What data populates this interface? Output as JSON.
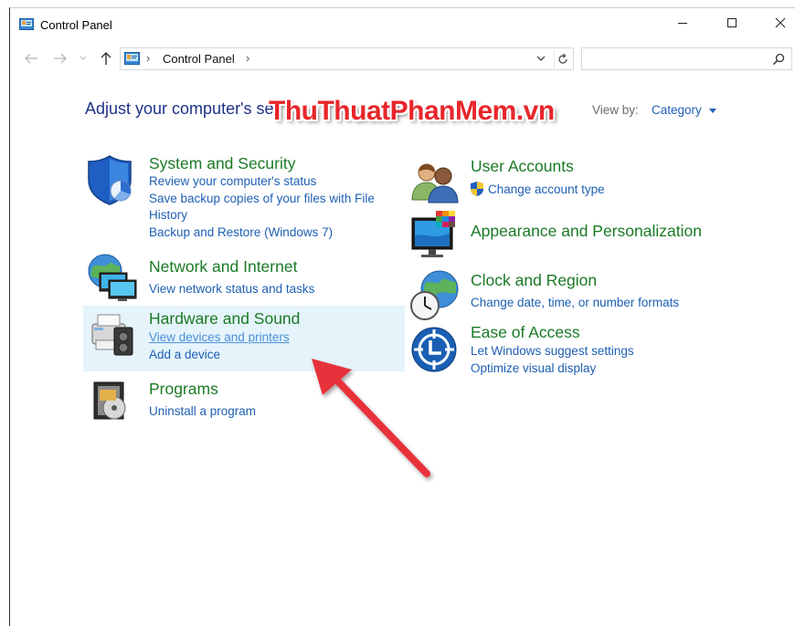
{
  "window": {
    "title": "Control Panel"
  },
  "address_bar": {
    "path": "Control Panel",
    "separator": "›"
  },
  "search": {
    "placeholder": "",
    "value": ""
  },
  "heading": "Adjust your computer's settings",
  "heading_visible": "Adjust your computer's se",
  "view_by": {
    "label": "View by:",
    "value": "Category"
  },
  "watermark": "ThuThuatPhanMem.vn",
  "categories": [
    {
      "title": "System and Security",
      "links": [
        "Review your computer's status",
        "Save backup copies of your files with File",
        "History",
        "Backup and Restore (Windows 7)"
      ]
    },
    {
      "title": "Network and Internet",
      "links": [
        "View network status and tasks"
      ]
    },
    {
      "title": "Hardware and Sound",
      "links": [
        "View devices and printers",
        "Add a device"
      ]
    },
    {
      "title": "Programs",
      "links": [
        "Uninstall a program"
      ]
    },
    {
      "title": "User Accounts",
      "links": [
        "Change account type"
      ]
    },
    {
      "title": "Appearance and Personalization",
      "links": []
    },
    {
      "title": "Clock and Region",
      "links": [
        "Change date, time, or number formats"
      ]
    },
    {
      "title": "Ease of Access",
      "links": [
        "Let Windows suggest settings",
        "Optimize visual display"
      ]
    }
  ],
  "colors": {
    "category_title": "#1a7a25",
    "link": "#1e5fb4",
    "heading": "#1e3287",
    "highlight": "#e5f3fb",
    "annotation_arrow": "#e8313b"
  },
  "icons": [
    "control-panel-icon",
    "back-arrow-icon",
    "forward-arrow-icon",
    "up-arrow-icon",
    "refresh-icon",
    "search-icon",
    "shield-icon",
    "network-icon",
    "printer-icon",
    "programs-icon",
    "users-icon",
    "monitor-icon",
    "globe-clock-icon",
    "ease-of-access-icon"
  ]
}
